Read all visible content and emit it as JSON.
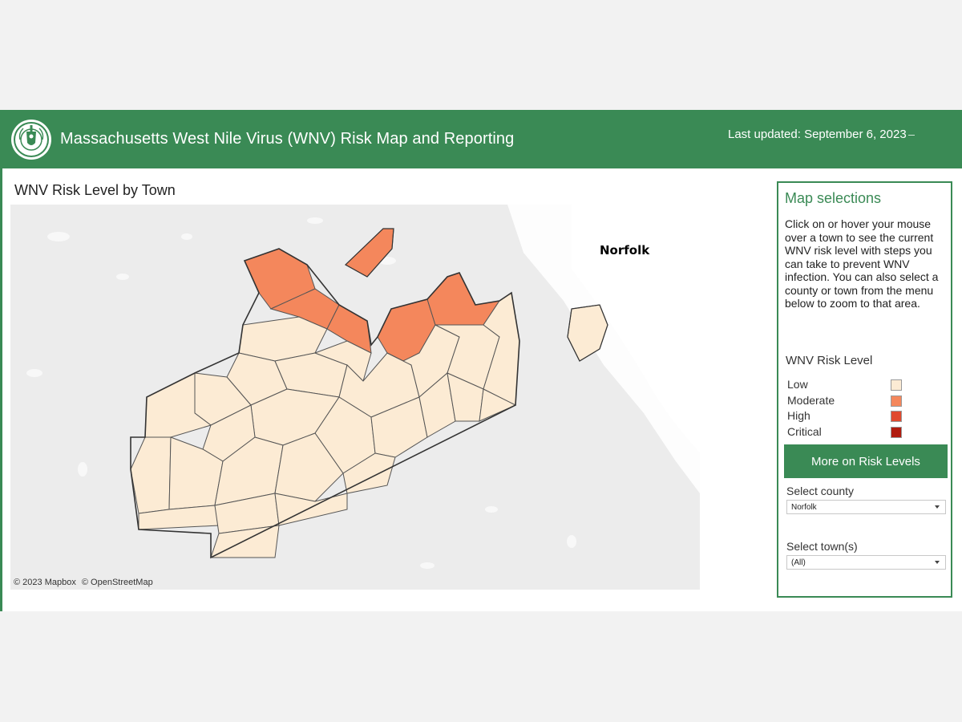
{
  "header": {
    "title": "Massachusetts West Nile Virus (WNV) Risk Map and Reporting",
    "last_updated": "Last updated: September 6, 2023",
    "seal_icon": "state-seal-icon"
  },
  "map": {
    "title": "WNV Risk Level by Town",
    "county_label": "Norfolk",
    "attribution": [
      "© 2023 Mapbox",
      "© OpenStreetMap"
    ],
    "towns": [
      {
        "risk": "Moderate"
      },
      {
        "risk": "Moderate"
      },
      {
        "risk": "Moderate"
      },
      {
        "risk": "Moderate"
      },
      {
        "risk": "Moderate"
      },
      {
        "risk": "Moderate"
      },
      {
        "risk": "Low"
      },
      {
        "risk": "Low"
      },
      {
        "risk": "Low"
      },
      {
        "risk": "Low"
      },
      {
        "risk": "Low"
      },
      {
        "risk": "Low"
      },
      {
        "risk": "Low"
      },
      {
        "risk": "Low"
      },
      {
        "risk": "Low"
      },
      {
        "risk": "Low"
      },
      {
        "risk": "Low"
      },
      {
        "risk": "Low"
      },
      {
        "risk": "Low"
      },
      {
        "risk": "Low"
      },
      {
        "risk": "Low"
      },
      {
        "risk": "Low"
      },
      {
        "risk": "Low"
      },
      {
        "risk": "Low"
      },
      {
        "risk": "Low"
      },
      {
        "risk": "Low"
      },
      {
        "risk": "Low"
      }
    ]
  },
  "panel": {
    "title": "Map selections",
    "description": "Click on or hover your mouse over a town to see the current WNV risk level with steps you can take to prevent WNV infection. You can also select a county or town from the menu below to zoom to that area.",
    "legend_title": "WNV Risk Level",
    "legend": [
      {
        "label": "Low",
        "color": "#fcebd4"
      },
      {
        "label": "Moderate",
        "color": "#f4875c"
      },
      {
        "label": "High",
        "color": "#e04a2f"
      },
      {
        "label": "Critical",
        "color": "#b01c0f"
      }
    ],
    "more_button": "More on Risk Levels",
    "county_select": {
      "label": "Select county",
      "value": "Norfolk"
    },
    "town_select": {
      "label": "Select town(s)",
      "value": "(All)"
    }
  },
  "colors": {
    "brand_green": "#3a8a55",
    "low": "#fcebd4",
    "moderate": "#f4875c"
  }
}
